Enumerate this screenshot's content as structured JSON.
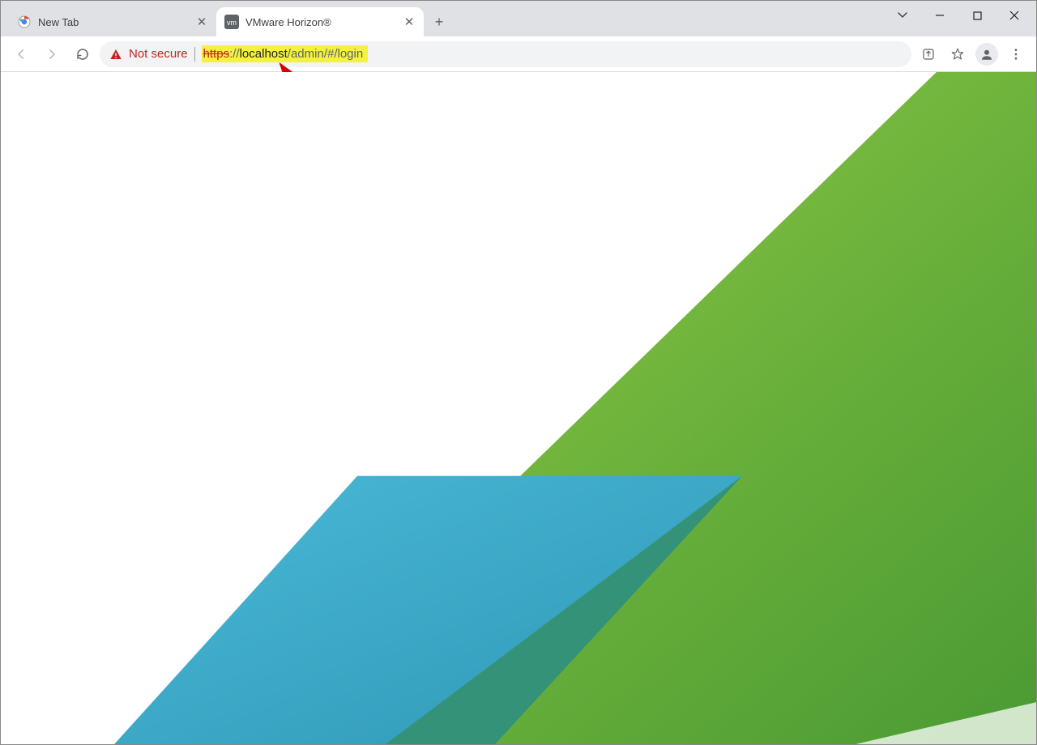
{
  "tabs": [
    {
      "title": "New Tab",
      "active": false,
      "favicon": "chrome"
    },
    {
      "title": "VMware Horizon®",
      "active": true,
      "favicon": "vm"
    }
  ],
  "window_controls": {
    "dropdown": "⌄",
    "minimize": "—",
    "maximize": "▢",
    "close": "✕"
  },
  "toolbar": {
    "not_secure_label": "Not secure",
    "url": {
      "scheme": "https",
      "separator": "://",
      "host": "localhost",
      "path": "/admin/#/login"
    },
    "newtab_plus": "+"
  },
  "annotation": {
    "highlight_url": true,
    "arrow_color": "#d40000"
  },
  "colors": {
    "green1": "#8bc53f",
    "green2": "#5aa436",
    "teal": "#36a9c6",
    "yellow": "#f4f142"
  }
}
